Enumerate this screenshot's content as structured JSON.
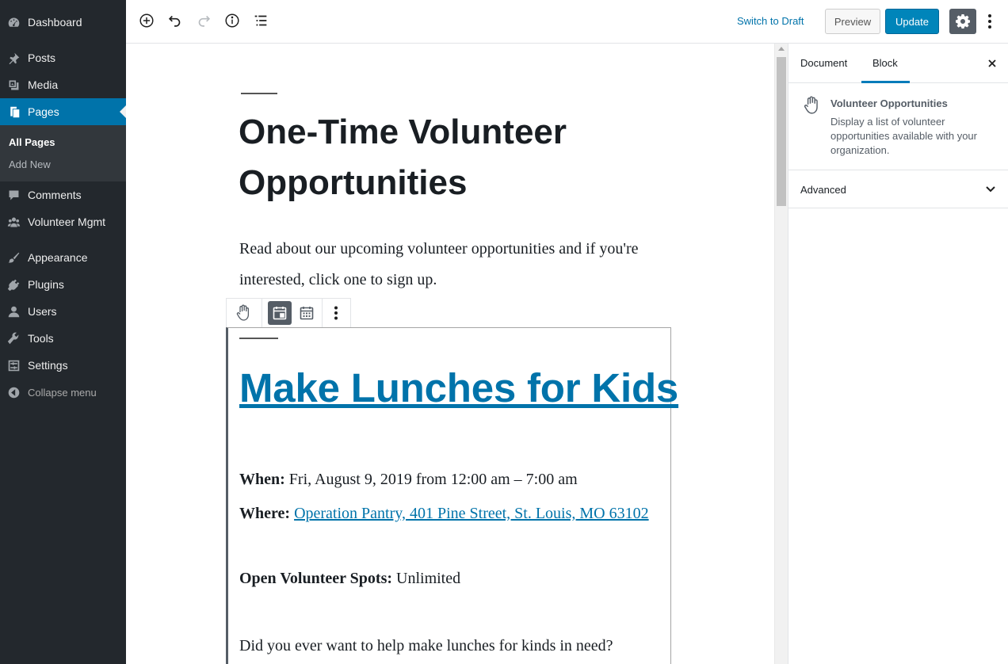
{
  "admin_menu": {
    "items": [
      {
        "label": "Dashboard",
        "icon": "dashboard-icon"
      },
      {
        "label": "Posts",
        "icon": "pin-icon"
      },
      {
        "label": "Media",
        "icon": "media-icon"
      },
      {
        "label": "Pages",
        "icon": "pages-icon"
      },
      {
        "label": "Comments",
        "icon": "comment-icon"
      },
      {
        "label": "Volunteer Mgmt",
        "icon": "groups-icon"
      },
      {
        "label": "Appearance",
        "icon": "brush-icon"
      },
      {
        "label": "Plugins",
        "icon": "plug-icon"
      },
      {
        "label": "Users",
        "icon": "user-icon"
      },
      {
        "label": "Tools",
        "icon": "wrench-icon"
      },
      {
        "label": "Settings",
        "icon": "settings-sliders-icon"
      }
    ],
    "submenu": {
      "all_pages": "All Pages",
      "add_new": "Add New"
    },
    "collapse_label": "Collapse menu"
  },
  "toolbar": {
    "switch_to_draft": "Switch to Draft",
    "preview": "Preview",
    "update": "Update",
    "icons": [
      "add-block-icon",
      "undo-icon",
      "redo-icon",
      "info-icon",
      "block-navigation-icon",
      "settings-gear-icon",
      "more-vertical-icon"
    ]
  },
  "editor": {
    "page_title": "One-Time Volunteer Opportunities",
    "intro_text": "Read about our upcoming volunteer opportunities and if you're interested, click one to sign up.",
    "event": {
      "title": "Make Lunches for Kids",
      "when_label": "When:",
      "when_value": "Fri, August 9, 2019 from 12:00 am – 7:00 am",
      "where_label": "Where:",
      "where_value": "Operation Pantry, 401 Pine Street, St. Louis, MO 63102",
      "spots_label": "Open Volunteer Spots:",
      "spots_value": "Unlimited",
      "description": "Did you ever want to help make lunches for kinds in need?"
    }
  },
  "settings_sidebar": {
    "tabs": [
      "Document",
      "Block"
    ],
    "active_tab": "Block",
    "block_name": "Volunteer Opportunities",
    "block_description": "Display a list of volunteer opportunities available with your organization.",
    "advanced_label": "Advanced"
  },
  "colors": {
    "admin_bg": "#23282d",
    "admin_current": "#0073aa",
    "update_button": "#0085ba",
    "link": "#0073aa"
  }
}
